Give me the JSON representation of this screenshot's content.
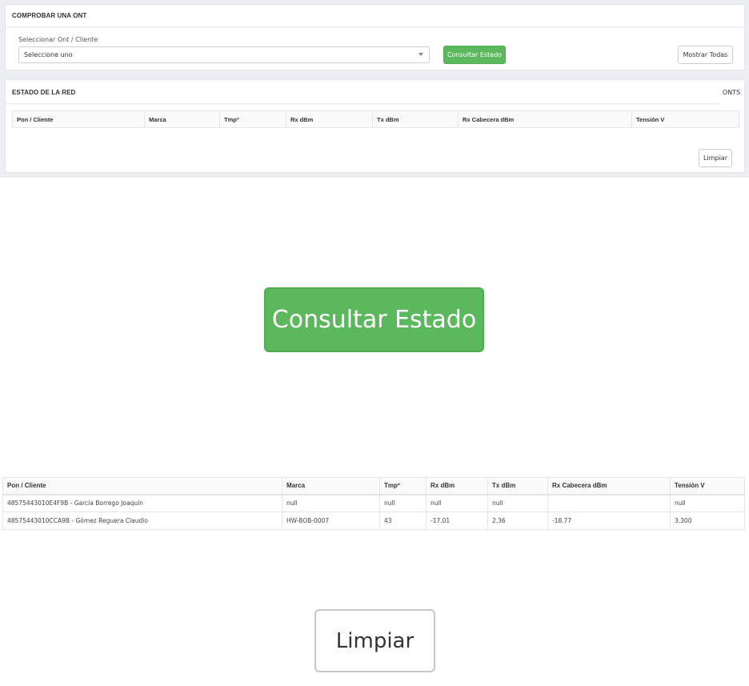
{
  "panel_ont": {
    "title": "COMPROBAR UNA ONT",
    "select_label": "Seleccionar Ont / Cliente",
    "select_value": "Seleccione uno",
    "consult_button": "Consultar Estado",
    "show_all_button": "Mostrar Todas"
  },
  "panel_network": {
    "title": "ESTADO DE LA RED",
    "tab": "ONTS",
    "columns": [
      "Pon / Cliente",
      "Marca",
      "Tmpº",
      "Rx dBm",
      "Tx dBm",
      "Rx Cabecera dBm",
      "Tensión V"
    ],
    "clear_button": "Limpiar"
  },
  "zoom_consult_button": "Consultar Estado",
  "results_table": {
    "columns": [
      "Pon / Cliente",
      "Marca",
      "Tmpº",
      "Rx dBm",
      "Tx dBm",
      "Rx Cabecera dBm",
      "Tensión V"
    ],
    "rows": [
      [
        "48575443010E4F9B - García Borrego Joaquín",
        "null",
        "null",
        "null",
        "null",
        "",
        "null"
      ],
      [
        "48575443010CCA9B - Gómez Reguera Claudio",
        "HW-BOB-0007",
        "43",
        "-17.01",
        "2.36",
        "-18.77",
        "3.300"
      ]
    ]
  },
  "zoom_clear_button": "Limpiar"
}
